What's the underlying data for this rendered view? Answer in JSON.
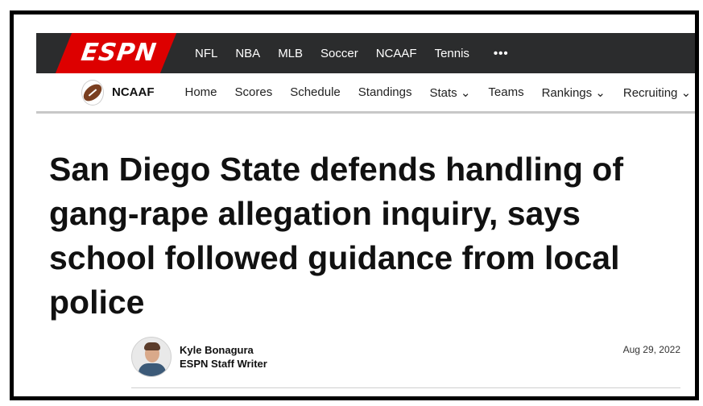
{
  "brand": {
    "logo_text": "ESPN"
  },
  "top_nav": {
    "items": [
      "NFL",
      "NBA",
      "MLB",
      "Soccer",
      "NCAAF",
      "Tennis"
    ],
    "more": "•••"
  },
  "sub_nav": {
    "section": "NCAAF",
    "items": [
      "Home",
      "Scores",
      "Schedule",
      "Standings",
      "Stats ⌄",
      "Teams",
      "Rankings ⌄",
      "Recruiting ⌄"
    ]
  },
  "article": {
    "headline": "San Diego State defends handling of gang-rape allegation inquiry, says school followed guidance from local police",
    "author": "Kyle Bonagura",
    "author_title": "ESPN Staff Writer",
    "date": "Aug 29, 2022"
  },
  "colors": {
    "brand_red": "#dd0000",
    "nav_bg": "#2b2c2d"
  },
  "icons": [
    "football-icon",
    "author-avatar"
  ]
}
